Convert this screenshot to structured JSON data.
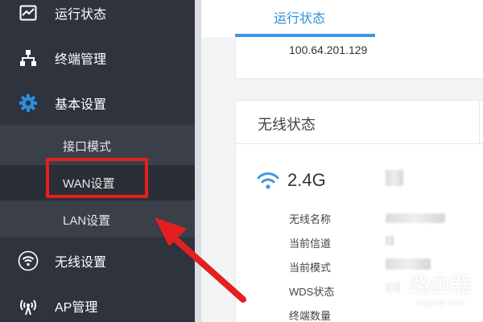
{
  "sidebar": {
    "items": [
      {
        "label": "运行状态",
        "icon": "chart-icon"
      },
      {
        "label": "终端管理",
        "icon": "network-icon"
      },
      {
        "label": "基本设置",
        "icon": "gear-icon"
      },
      {
        "label": "无线设置",
        "icon": "wifi-icon"
      },
      {
        "label": "AP管理",
        "icon": "antenna-icon"
      }
    ],
    "subitems": [
      {
        "label": "接口模式"
      },
      {
        "label": "WAN设置",
        "highlighted": true
      },
      {
        "label": "LAN设置"
      }
    ]
  },
  "main": {
    "active_tab": "运行状态",
    "wan_card": {
      "ip": "100.64.201.129"
    },
    "wireless": {
      "title": "无线状态",
      "band": "2.4G",
      "fields": [
        "无线名称",
        "当前信道",
        "当前模式",
        "WDS状态",
        "终端数量"
      ]
    }
  },
  "watermark": {
    "brand": "路由器",
    "site": "luyouqi.com"
  },
  "colors": {
    "sidebar_bg": "#2e333d",
    "submenu_bg": "#3a3f4a",
    "accent_blue": "#2b8fdc",
    "highlight_red": "#e41f1f"
  }
}
